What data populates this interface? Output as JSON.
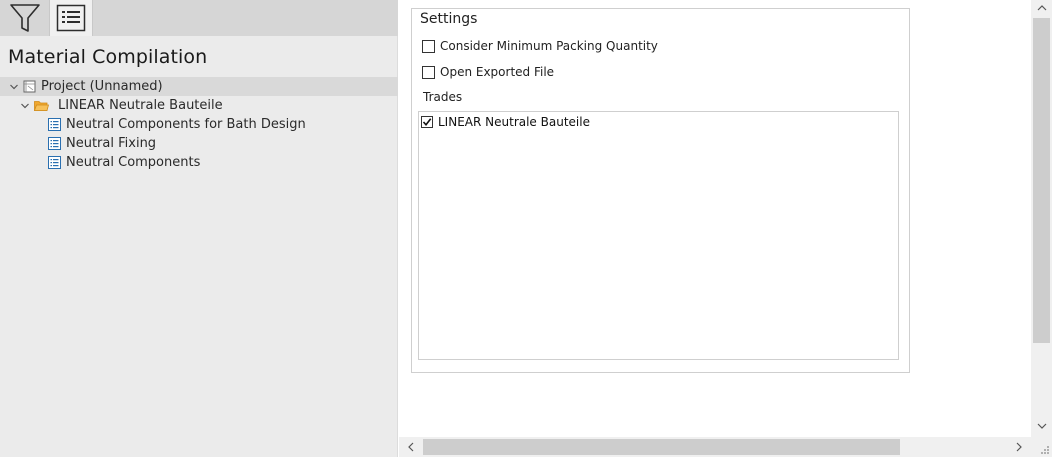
{
  "toolbar": {
    "buttons": [
      {
        "icon": "filter-icon"
      },
      {
        "icon": "list-view-icon",
        "active": true
      }
    ]
  },
  "panel": {
    "title": "Material Compilation"
  },
  "tree": [
    {
      "label": "Project (Unnamed)",
      "icon": "project-icon",
      "level": 0,
      "expanded": true,
      "selected": true
    },
    {
      "label": "LINEAR Neutrale Bauteile",
      "icon": "folder-icon",
      "level": 1,
      "expanded": true
    },
    {
      "label": "Neutral Components for Bath Design",
      "icon": "list-icon",
      "level": 2
    },
    {
      "label": "Neutral Fixing",
      "icon": "list-icon",
      "level": 2
    },
    {
      "label": "Neutral Components",
      "icon": "list-icon",
      "level": 2
    }
  ],
  "settings": {
    "label": "Settings",
    "min_packing": {
      "label": "Consider Minimum Packing Quantity",
      "checked": false
    },
    "open_exported": {
      "label": "Open Exported File",
      "checked": false
    },
    "trades_label": "Trades",
    "trades": [
      {
        "label": "LINEAR Neutrale Bauteile",
        "checked": true
      }
    ]
  },
  "colors": {
    "left_bg": "#ebebeb",
    "toolbar_bg": "#d6d6d6",
    "folder": "#f0a830",
    "list_icon": "#2a6fb0"
  }
}
